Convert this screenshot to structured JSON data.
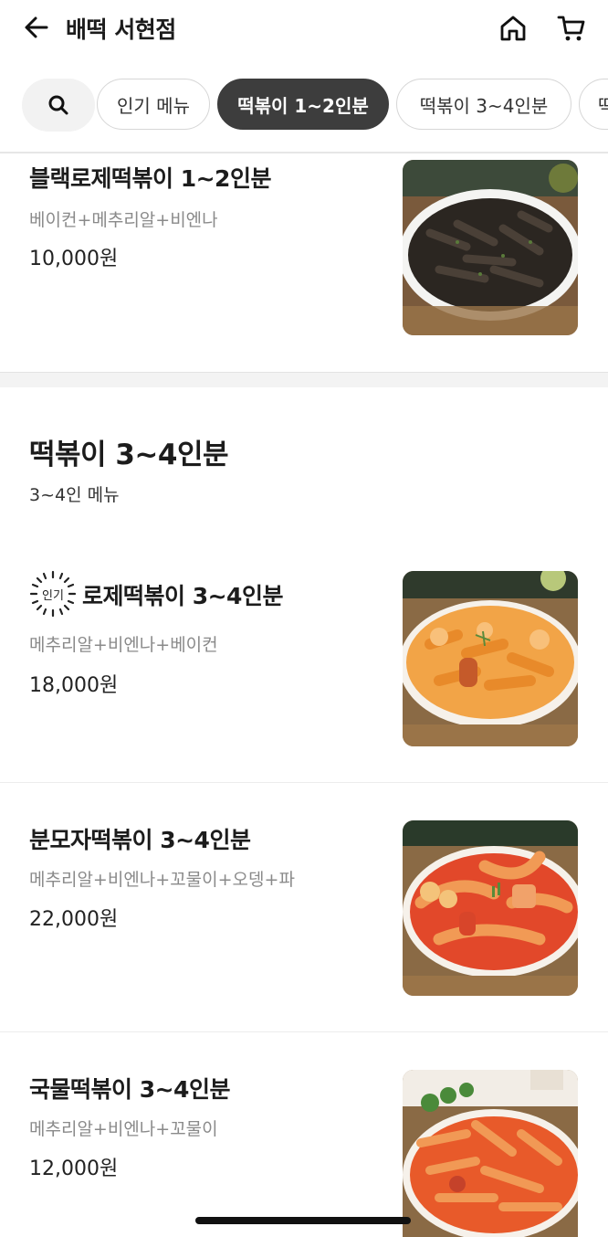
{
  "header": {
    "store_name": "배떡 서현점",
    "back_icon": "arrow-left-icon",
    "home_icon": "home-icon",
    "cart_icon": "cart-icon"
  },
  "tabs": {
    "search_icon": "search-icon",
    "items": [
      {
        "label": "인기 메뉴",
        "active": false
      },
      {
        "label": "떡볶이 1~2인분",
        "active": true
      },
      {
        "label": "떡볶이 3~4인분",
        "active": false
      },
      {
        "label": "떡",
        "active": false
      }
    ]
  },
  "menu_top": {
    "title": "블랙로제떡볶이 1~2인분",
    "description": "베이컨+메추리알+비엔나",
    "price": "10,000원"
  },
  "section": {
    "title": "떡볶이 3~4인분",
    "subtitle": "3~4인 메뉴",
    "items": [
      {
        "badge": "인기",
        "title": "로제떡볶이 3~4인분",
        "description": "메추리알+비엔나+베이컨",
        "price": "18,000원"
      },
      {
        "title": "분모자떡볶이 3~4인분",
        "description": "메추리알+비엔나+꼬물이+오뎅+파",
        "price": "22,000원"
      },
      {
        "title": "국물떡볶이 3~4인분",
        "description": "메추리알+비엔나+꼬물이",
        "price": "12,000원"
      }
    ]
  },
  "colors": {
    "active_chip": "#3d3d3d",
    "muted_text": "#8a8a8a",
    "rose_sauce": "#f2a447",
    "red_sauce": "#e2482a",
    "black_sauce": "#2b2621"
  }
}
